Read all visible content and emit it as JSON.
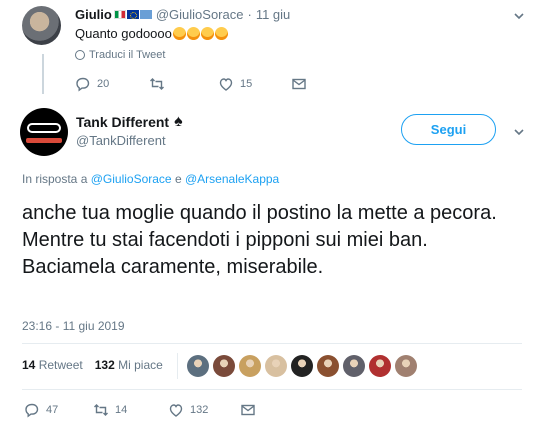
{
  "reply_tweet": {
    "name": "Giulio",
    "handle": "@GiulioSorace",
    "time": "11 giu",
    "text": "Quanto godoooo",
    "emoji_count": 4,
    "translate_label": "Traduci il Tweet",
    "reply_count": "20",
    "retweet_count": "",
    "like_count": "15"
  },
  "main_tweet": {
    "name": "Tank Different",
    "name_symbol": "♠",
    "handle": "@TankDifferent",
    "follow_label": "Segui",
    "in_reply_prefix": "In risposta a",
    "in_reply_user1": "@GiulioSorace",
    "in_reply_and": "e",
    "in_reply_user2": "@ArsenaleKappa",
    "text": "anche tua moglie quando il postino la mette a pecora. Mentre tu stai facendoti i pipponi sui miei ban. Baciamela caramente, miserabile.",
    "timestamp": "23:16 - 11 giu 2019",
    "retweets_value": "14",
    "retweets_label": "Retweet",
    "likes_value": "132",
    "likes_label": "Mi piace",
    "reply_count": "47",
    "retweet_count": "14",
    "like_count": "132"
  },
  "liker_avatar_colors": [
    "#5c6f7f",
    "#7a4a3a",
    "#c8a060",
    "#d8c0a0",
    "#222222",
    "#8a5030",
    "#60606a",
    "#b03030",
    "#a08070"
  ],
  "colors": {
    "accent": "#1da1f2",
    "muted": "#657786",
    "text": "#14171a",
    "divider": "#e6ecf0"
  }
}
